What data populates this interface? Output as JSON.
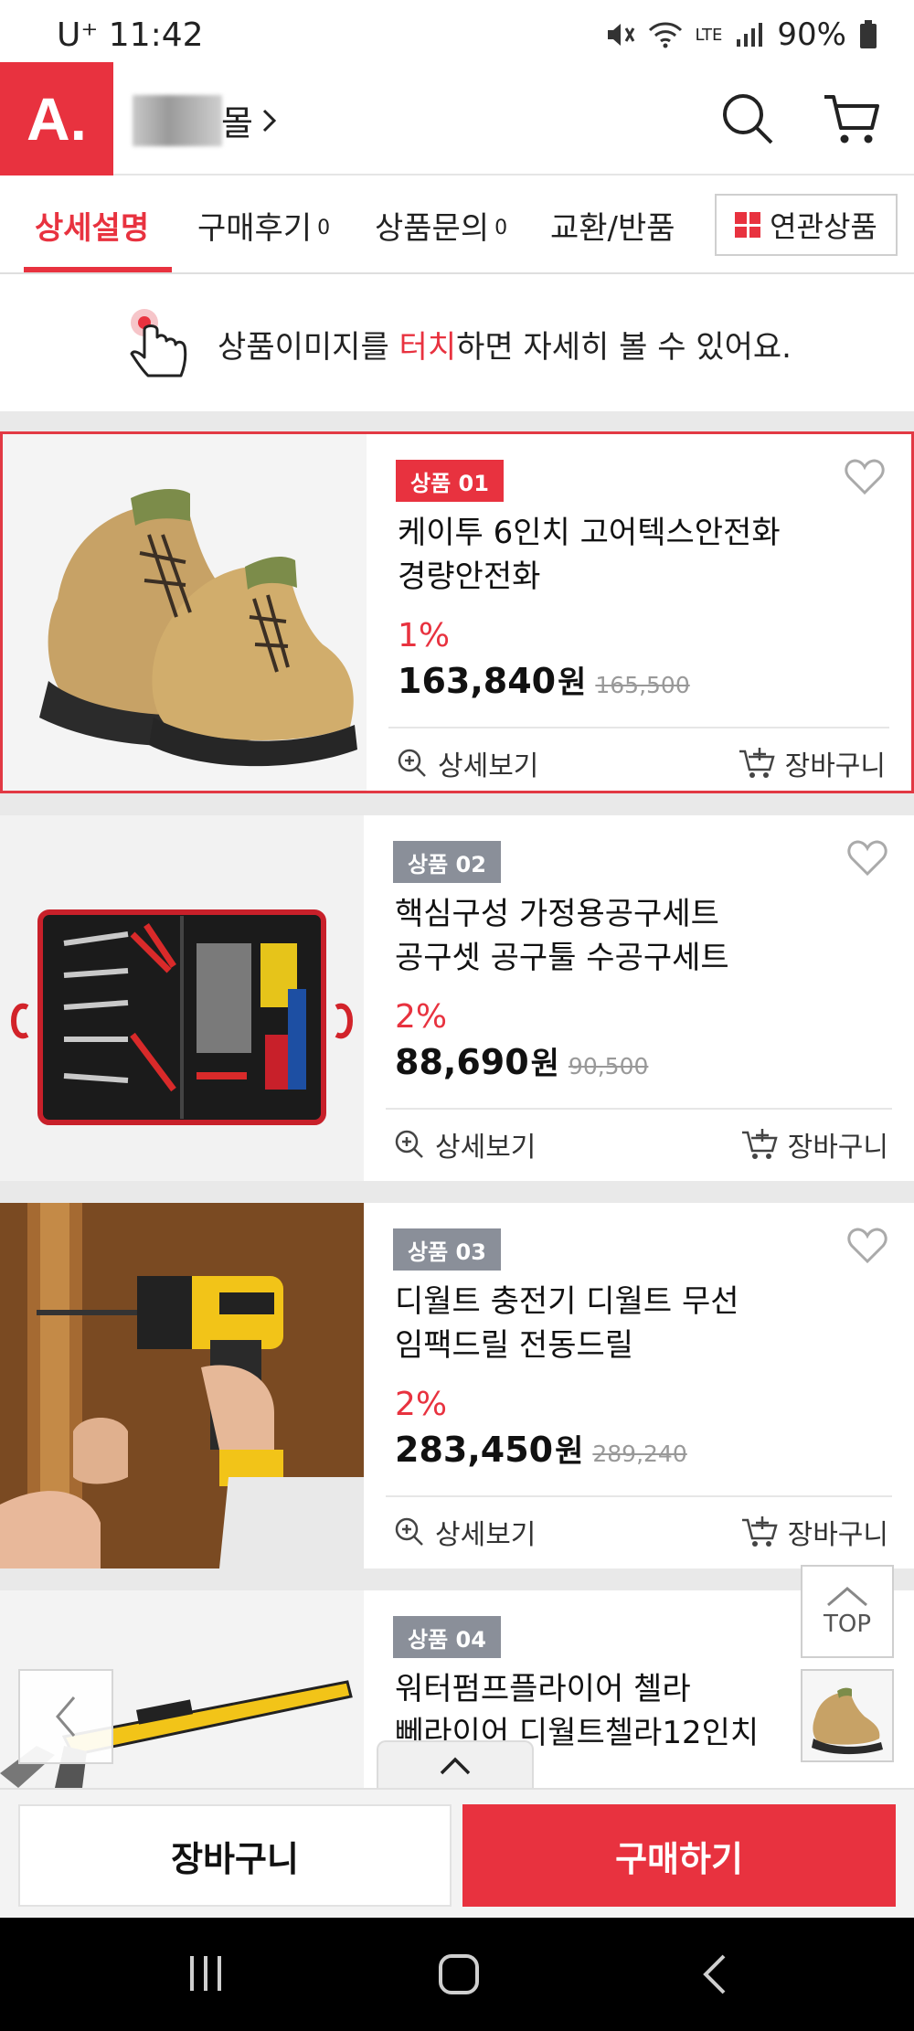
{
  "status_bar": {
    "carrier": "U⁺ 11:42",
    "network": "LTE",
    "battery": "90%"
  },
  "header": {
    "logo_text": "A.",
    "shop_name_suffix": "몰"
  },
  "tabs": [
    {
      "label": "상세설명",
      "count": ""
    },
    {
      "label": "구매후기",
      "count": "0"
    },
    {
      "label": "상품문의",
      "count": "0"
    },
    {
      "label": "교환/반품",
      "count": ""
    }
  ],
  "related_button": "연관상품",
  "notice": {
    "before": "상품이미지를 ",
    "highlight": "터치",
    "after": "하면 자세히 볼 수 있어요."
  },
  "products": [
    {
      "badge": "상품 01",
      "name_line1": "케이투 6인치 고어텍스안전화",
      "name_line2": "경량안전화",
      "discount": "1%",
      "price": "163,840",
      "won": "원",
      "original": "165,500",
      "detail_label": "상세보기",
      "cart_label": "장바구니"
    },
    {
      "badge": "상품 02",
      "name_line1": "핵심구성 가정용공구세트",
      "name_line2": "공구셋 공구툴 수공구세트",
      "discount": "2%",
      "price": "88,690",
      "won": "원",
      "original": "90,500",
      "detail_label": "상세보기",
      "cart_label": "장바구니"
    },
    {
      "badge": "상품 03",
      "name_line1": "디월트 충전기 디월트 무선",
      "name_line2": "임팩드릴 전동드릴",
      "discount": "2%",
      "price": "283,450",
      "won": "원",
      "original": "289,240",
      "detail_label": "상세보기",
      "cart_label": "장바구니"
    },
    {
      "badge": "상품 04",
      "name_line1": "워터펌프플라이어 첼라",
      "name_line2": "뻬라이어 디월트첼라12인치"
    }
  ],
  "top_button": "TOP",
  "bottom_bar": {
    "cart": "장바구니",
    "buy": "구매하기"
  },
  "colors": {
    "accent": "#e8323f",
    "badge_gray": "#8a8f99"
  }
}
